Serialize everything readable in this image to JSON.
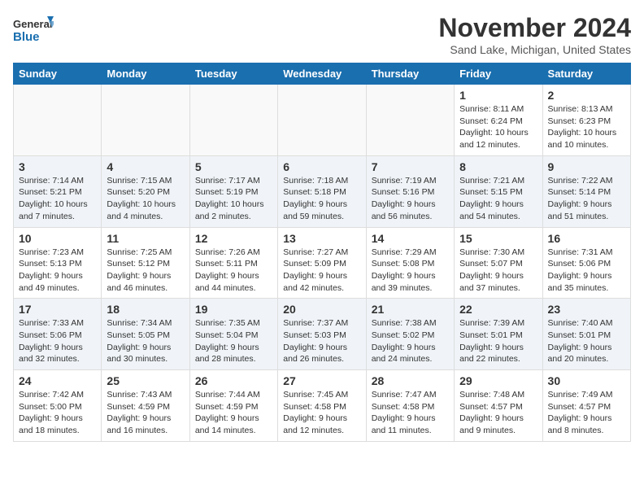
{
  "header": {
    "logo_line1": "General",
    "logo_line2": "Blue",
    "month_title": "November 2024",
    "location": "Sand Lake, Michigan, United States"
  },
  "weekdays": [
    "Sunday",
    "Monday",
    "Tuesday",
    "Wednesday",
    "Thursday",
    "Friday",
    "Saturday"
  ],
  "weeks": [
    [
      {
        "day": "",
        "info": ""
      },
      {
        "day": "",
        "info": ""
      },
      {
        "day": "",
        "info": ""
      },
      {
        "day": "",
        "info": ""
      },
      {
        "day": "",
        "info": ""
      },
      {
        "day": "1",
        "info": "Sunrise: 8:11 AM\nSunset: 6:24 PM\nDaylight: 10 hours and 12 minutes."
      },
      {
        "day": "2",
        "info": "Sunrise: 8:13 AM\nSunset: 6:23 PM\nDaylight: 10 hours and 10 minutes."
      }
    ],
    [
      {
        "day": "3",
        "info": "Sunrise: 7:14 AM\nSunset: 5:21 PM\nDaylight: 10 hours and 7 minutes."
      },
      {
        "day": "4",
        "info": "Sunrise: 7:15 AM\nSunset: 5:20 PM\nDaylight: 10 hours and 4 minutes."
      },
      {
        "day": "5",
        "info": "Sunrise: 7:17 AM\nSunset: 5:19 PM\nDaylight: 10 hours and 2 minutes."
      },
      {
        "day": "6",
        "info": "Sunrise: 7:18 AM\nSunset: 5:18 PM\nDaylight: 9 hours and 59 minutes."
      },
      {
        "day": "7",
        "info": "Sunrise: 7:19 AM\nSunset: 5:16 PM\nDaylight: 9 hours and 56 minutes."
      },
      {
        "day": "8",
        "info": "Sunrise: 7:21 AM\nSunset: 5:15 PM\nDaylight: 9 hours and 54 minutes."
      },
      {
        "day": "9",
        "info": "Sunrise: 7:22 AM\nSunset: 5:14 PM\nDaylight: 9 hours and 51 minutes."
      }
    ],
    [
      {
        "day": "10",
        "info": "Sunrise: 7:23 AM\nSunset: 5:13 PM\nDaylight: 9 hours and 49 minutes."
      },
      {
        "day": "11",
        "info": "Sunrise: 7:25 AM\nSunset: 5:12 PM\nDaylight: 9 hours and 46 minutes."
      },
      {
        "day": "12",
        "info": "Sunrise: 7:26 AM\nSunset: 5:11 PM\nDaylight: 9 hours and 44 minutes."
      },
      {
        "day": "13",
        "info": "Sunrise: 7:27 AM\nSunset: 5:09 PM\nDaylight: 9 hours and 42 minutes."
      },
      {
        "day": "14",
        "info": "Sunrise: 7:29 AM\nSunset: 5:08 PM\nDaylight: 9 hours and 39 minutes."
      },
      {
        "day": "15",
        "info": "Sunrise: 7:30 AM\nSunset: 5:07 PM\nDaylight: 9 hours and 37 minutes."
      },
      {
        "day": "16",
        "info": "Sunrise: 7:31 AM\nSunset: 5:06 PM\nDaylight: 9 hours and 35 minutes."
      }
    ],
    [
      {
        "day": "17",
        "info": "Sunrise: 7:33 AM\nSunset: 5:06 PM\nDaylight: 9 hours and 32 minutes."
      },
      {
        "day": "18",
        "info": "Sunrise: 7:34 AM\nSunset: 5:05 PM\nDaylight: 9 hours and 30 minutes."
      },
      {
        "day": "19",
        "info": "Sunrise: 7:35 AM\nSunset: 5:04 PM\nDaylight: 9 hours and 28 minutes."
      },
      {
        "day": "20",
        "info": "Sunrise: 7:37 AM\nSunset: 5:03 PM\nDaylight: 9 hours and 26 minutes."
      },
      {
        "day": "21",
        "info": "Sunrise: 7:38 AM\nSunset: 5:02 PM\nDaylight: 9 hours and 24 minutes."
      },
      {
        "day": "22",
        "info": "Sunrise: 7:39 AM\nSunset: 5:01 PM\nDaylight: 9 hours and 22 minutes."
      },
      {
        "day": "23",
        "info": "Sunrise: 7:40 AM\nSunset: 5:01 PM\nDaylight: 9 hours and 20 minutes."
      }
    ],
    [
      {
        "day": "24",
        "info": "Sunrise: 7:42 AM\nSunset: 5:00 PM\nDaylight: 9 hours and 18 minutes."
      },
      {
        "day": "25",
        "info": "Sunrise: 7:43 AM\nSunset: 4:59 PM\nDaylight: 9 hours and 16 minutes."
      },
      {
        "day": "26",
        "info": "Sunrise: 7:44 AM\nSunset: 4:59 PM\nDaylight: 9 hours and 14 minutes."
      },
      {
        "day": "27",
        "info": "Sunrise: 7:45 AM\nSunset: 4:58 PM\nDaylight: 9 hours and 12 minutes."
      },
      {
        "day": "28",
        "info": "Sunrise: 7:47 AM\nSunset: 4:58 PM\nDaylight: 9 hours and 11 minutes."
      },
      {
        "day": "29",
        "info": "Sunrise: 7:48 AM\nSunset: 4:57 PM\nDaylight: 9 hours and 9 minutes."
      },
      {
        "day": "30",
        "info": "Sunrise: 7:49 AM\nSunset: 4:57 PM\nDaylight: 9 hours and 8 minutes."
      }
    ]
  ]
}
